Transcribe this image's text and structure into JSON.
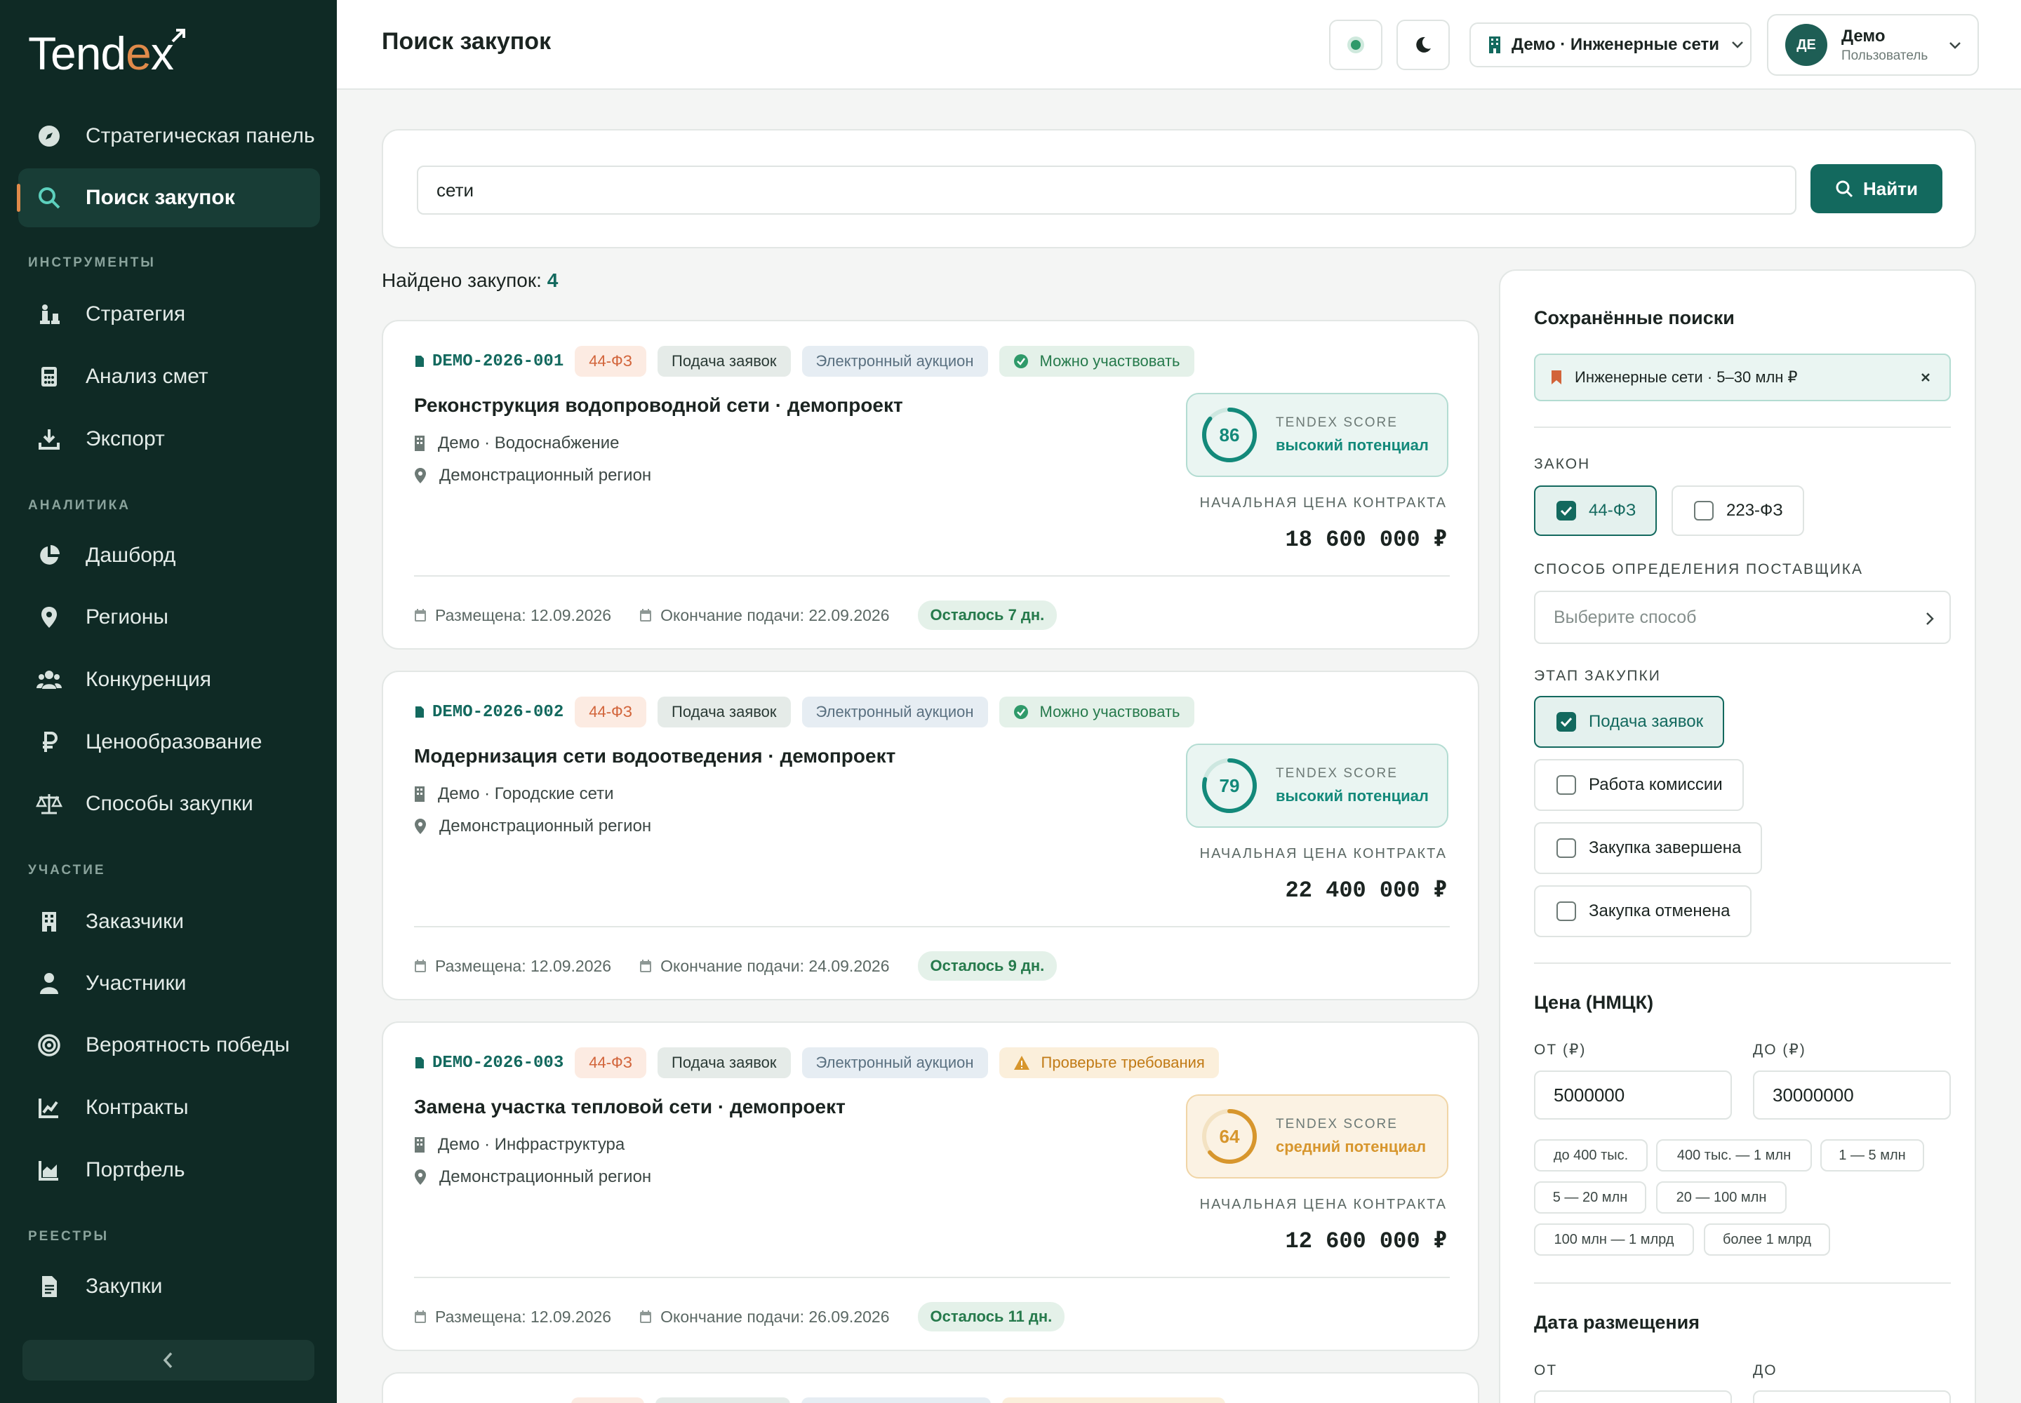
{
  "brand": {
    "pre": "Tend",
    "accent": "e",
    "post": "x"
  },
  "nav": {
    "strategic": "Стратегическая панель",
    "search": "Поиск закупок",
    "sec_tools": "ИНСТРУМЕНТЫ",
    "strategy": "Стратегия",
    "estimates": "Анализ смет",
    "export": "Экспорт",
    "sec_analytics": "АНАЛИТИКА",
    "dashboard": "Дашборд",
    "regions": "Регионы",
    "competition": "Конкуренция",
    "pricing": "Ценообразование",
    "methods": "Способы закупки",
    "sec_participation": "УЧАСТИЕ",
    "customers": "Заказчики",
    "participants": "Участники",
    "win": "Вероятность победы",
    "contracts": "Контракты",
    "portfolio": "Портфель",
    "sec_registries": "РЕЕСТРЫ",
    "purchases": "Закупки"
  },
  "header": {
    "title": "Поиск закупок",
    "org": "Демо · Инженерные сети",
    "user_initials": "ДЕ",
    "user_name": "Демо",
    "user_role": "Пользователь"
  },
  "search": {
    "value": "сети",
    "button": "Найти"
  },
  "results": {
    "label": "Найдено закупок: ",
    "count": "4"
  },
  "cards": [
    {
      "id": "DEMO-2026-001",
      "law": "44-ФЗ",
      "stage": "Подача заявок",
      "method": "Электронный аукцион",
      "status": "Можно участвовать",
      "title": "Реконструкция водопроводной сети · демопроект",
      "customer": "Демо · Водоснабжение",
      "region": "Демонстрационный регион",
      "score": 86,
      "score_caption": "TENDEX SCORE",
      "score_label": "высокий потенциал",
      "price_caption": "НАЧАЛЬНАЯ ЦЕНА КОНТРАКТА",
      "price": "18 600 000 ₽",
      "posted": "Размещена: 12.09.2026",
      "deadline": "Окончание подачи: 22.09.2026",
      "remaining": "Осталось 7 дн."
    },
    {
      "id": "DEMO-2026-002",
      "law": "44-ФЗ",
      "stage": "Подача заявок",
      "method": "Электронный аукцион",
      "status": "Можно участвовать",
      "title": "Модернизация сети водоотведения · демопроект",
      "customer": "Демо · Городские сети",
      "region": "Демонстрационный регион",
      "score": 79,
      "score_caption": "TENDEX SCORE",
      "score_label": "высокий потенциал",
      "price_caption": "НАЧАЛЬНАЯ ЦЕНА КОНТРАКТА",
      "price": "22 400 000 ₽",
      "posted": "Размещена: 12.09.2026",
      "deadline": "Окончание подачи: 24.09.2026",
      "remaining": "Осталось 9 дн."
    },
    {
      "id": "DEMO-2026-003",
      "law": "44-ФЗ",
      "stage": "Подача заявок",
      "method": "Электронный аукцион",
      "status": "Проверьте требования",
      "title": "Замена участка тепловой сети · демопроект",
      "customer": "Демо · Инфраструктура",
      "region": "Демонстрационный регион",
      "score": 64,
      "score_caption": "TENDEX SCORE",
      "score_label": "средний потенциал",
      "price_caption": "НАЧАЛЬНАЯ ЦЕНА КОНТРАКТА",
      "price": "12 600 000 ₽",
      "posted": "Размещена: 12.09.2026",
      "deadline": "Окончание подачи: 26.09.2026",
      "remaining": "Осталось 11 дн."
    }
  ],
  "filters": {
    "saved_title": "Сохранённые поиски",
    "saved_item": "Инженерные сети · 5–30 млн ₽",
    "law_caption": "ЗАКОН",
    "law_options": [
      {
        "label": "44-ФЗ",
        "checked": true
      },
      {
        "label": "223-ФЗ",
        "checked": false
      }
    ],
    "method_caption": "СПОСОБ ОПРЕДЕЛЕНИЯ ПОСТАВЩИКА",
    "method_placeholder": "Выберите способ",
    "stage_caption": "ЭТАП ЗАКУПКИ",
    "stage_options": [
      {
        "label": "Подача заявок",
        "checked": true
      },
      {
        "label": "Работа комиссии",
        "checked": false
      },
      {
        "label": "Закупка завершена",
        "checked": false
      },
      {
        "label": "Закупка отменена",
        "checked": false
      }
    ],
    "price_title": "Цена (НМЦК)",
    "price_from_caption": "ОТ (₽)",
    "price_to_caption": "ДО (₽)",
    "price_from": "5000000",
    "price_to": "30000000",
    "price_chips": [
      "до 400 тыс.",
      "400 тыс. — 1 млн",
      "1 — 5 млн",
      "5 — 20 млн",
      "20 — 100 млн",
      "100 млн — 1 млрд",
      "более 1 млрд"
    ],
    "date_title": "Дата размещения",
    "date_from_caption": "ОТ",
    "date_to_caption": "ДО"
  },
  "colors": {
    "sidebar": "#0f2a25",
    "accent": "#13695e",
    "brand_orange": "#e08a4a",
    "score_high": "#13897a",
    "score_mid": "#d7962d"
  }
}
